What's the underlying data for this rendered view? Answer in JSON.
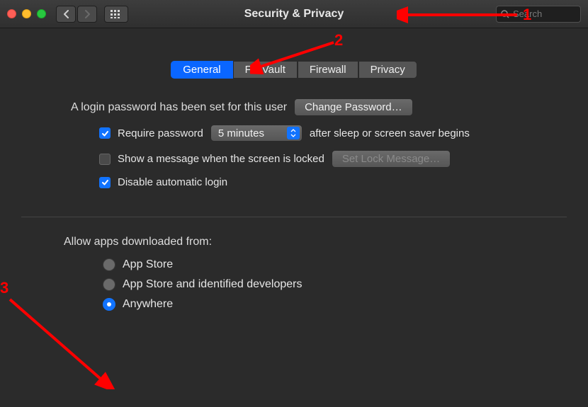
{
  "window": {
    "title": "Security & Privacy",
    "search_placeholder": "Search"
  },
  "tabs": [
    {
      "label": "General",
      "active": true
    },
    {
      "label": "FileVault",
      "active": false
    },
    {
      "label": "Firewall",
      "active": false
    },
    {
      "label": "Privacy",
      "active": false
    }
  ],
  "login": {
    "text": "A login password has been set for this user",
    "change_button": "Change Password…"
  },
  "options": {
    "require_password_checked": true,
    "require_password_label_before": "Require password",
    "require_password_delay": "5 minutes",
    "require_password_label_after": "after sleep or screen saver begins",
    "show_message_checked": false,
    "show_message_label": "Show a message when the screen is locked",
    "set_message_button": "Set Lock Message…",
    "disable_auto_login_checked": true,
    "disable_auto_login_label": "Disable automatic login"
  },
  "apps_section": {
    "label": "Allow apps downloaded from:",
    "choices": [
      {
        "label": "App Store",
        "selected": false,
        "enabled": false
      },
      {
        "label": "App Store and identified developers",
        "selected": false,
        "enabled": false
      },
      {
        "label": "Anywhere",
        "selected": true,
        "enabled": true
      }
    ]
  },
  "annotations": {
    "n1": "1",
    "n2": "2",
    "n3": "3"
  }
}
